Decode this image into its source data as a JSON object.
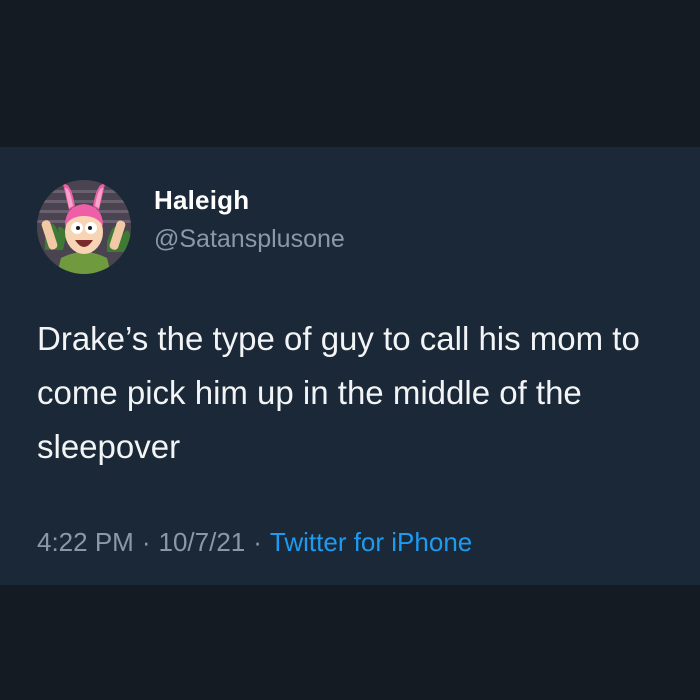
{
  "tweet": {
    "display_name": "Haleigh",
    "handle": "@Satansplusone",
    "text": "Drake’s the type of guy to call his mom to come pick him up in the middle of the sleepover",
    "time": "4:22 PM",
    "separator": "·",
    "date": "10/7/21",
    "source": "Twitter for iPhone"
  },
  "colors": {
    "background": "#141b23",
    "card": "#1b2837",
    "name": "#ffffff",
    "handle": "#8b98a5",
    "text": "#f2f4f6",
    "link": "#1d9bf0"
  },
  "avatar": {
    "icon": "cartoon-character-avatar"
  }
}
